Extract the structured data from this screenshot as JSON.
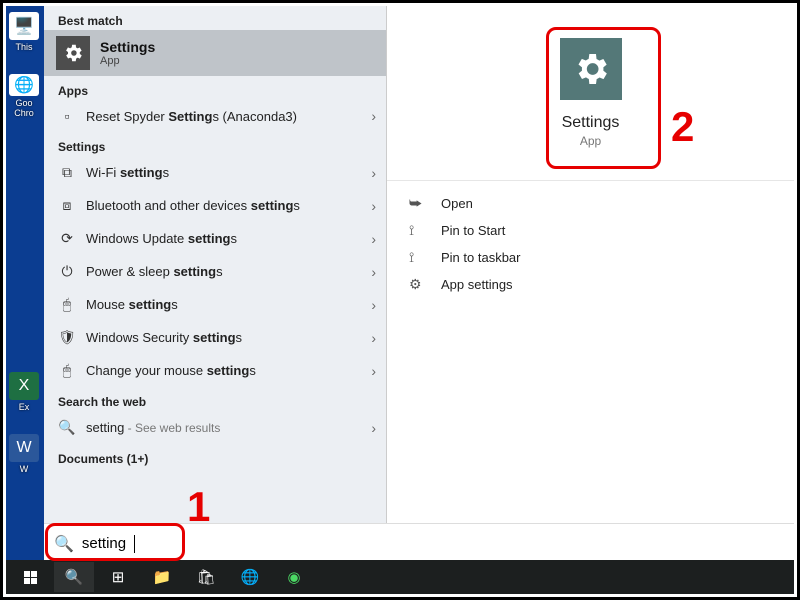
{
  "desktop": {
    "icons": [
      {
        "label": "This"
      },
      {
        "label": "Goo Chro"
      },
      {
        "label": ""
      },
      {
        "label": ""
      },
      {
        "label": ""
      },
      {
        "label": "Ex"
      },
      {
        "label": "W"
      }
    ]
  },
  "panel": {
    "best_match_header": "Best match",
    "best_match": {
      "title": "Settings",
      "subtitle": "App"
    },
    "apps_header": "Apps",
    "apps": [
      {
        "label_before": "Reset Spyder ",
        "bold": "Setting",
        "label_after": "s (Anaconda3)"
      }
    ],
    "settings_header": "Settings",
    "settings": [
      {
        "icon": "wifi",
        "label_before": "Wi-Fi ",
        "bold": "setting",
        "label_after": "s"
      },
      {
        "icon": "bt",
        "label_before": "Bluetooth and other devices ",
        "bold": "setting",
        "label_after": "s"
      },
      {
        "icon": "update",
        "label_before": "Windows Update ",
        "bold": "setting",
        "label_after": "s"
      },
      {
        "icon": "power",
        "label_before": "Power & sleep ",
        "bold": "setting",
        "label_after": "s"
      },
      {
        "icon": "mouse",
        "label_before": "Mouse ",
        "bold": "setting",
        "label_after": "s"
      },
      {
        "icon": "shield",
        "label_before": "Windows Security ",
        "bold": "setting",
        "label_after": "s"
      },
      {
        "icon": "mouse",
        "label_before": "Change your mouse ",
        "bold": "setting",
        "label_after": "s"
      }
    ],
    "web_header": "Search the web",
    "web": {
      "query": "setting",
      "hint": " - See web results"
    },
    "docs_header": "Documents (1+)"
  },
  "detail": {
    "title": "Settings",
    "subtitle": "App",
    "actions": [
      {
        "icon": "open",
        "label": "Open"
      },
      {
        "icon": "pin-start",
        "label": "Pin to Start"
      },
      {
        "icon": "pin-tb",
        "label": "Pin to taskbar"
      },
      {
        "icon": "gear",
        "label": "App settings"
      }
    ]
  },
  "searchbox": {
    "value": "setting"
  },
  "annotations": {
    "one": "1",
    "two": "2"
  }
}
